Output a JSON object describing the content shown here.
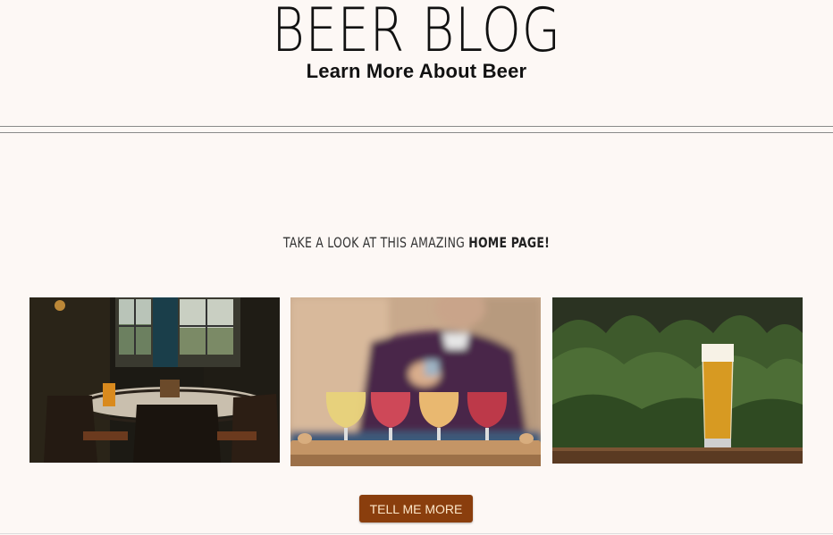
{
  "header": {
    "title": "BEER BLOG",
    "tagline": "Learn More About Beer"
  },
  "intro": {
    "text": "TAKE A LOOK AT THIS AMAZING ",
    "highlight": "HOME PAGE!"
  },
  "gallery": [
    {
      "name": "pub-interior-photo"
    },
    {
      "name": "beer-flight-photo"
    },
    {
      "name": "beer-glass-garden-photo"
    }
  ],
  "cta": {
    "label": "TELL ME MORE"
  },
  "colors": {
    "background": "#fdf8f5",
    "button": "#8a3e0d",
    "button_text": "#fde7c9"
  }
}
